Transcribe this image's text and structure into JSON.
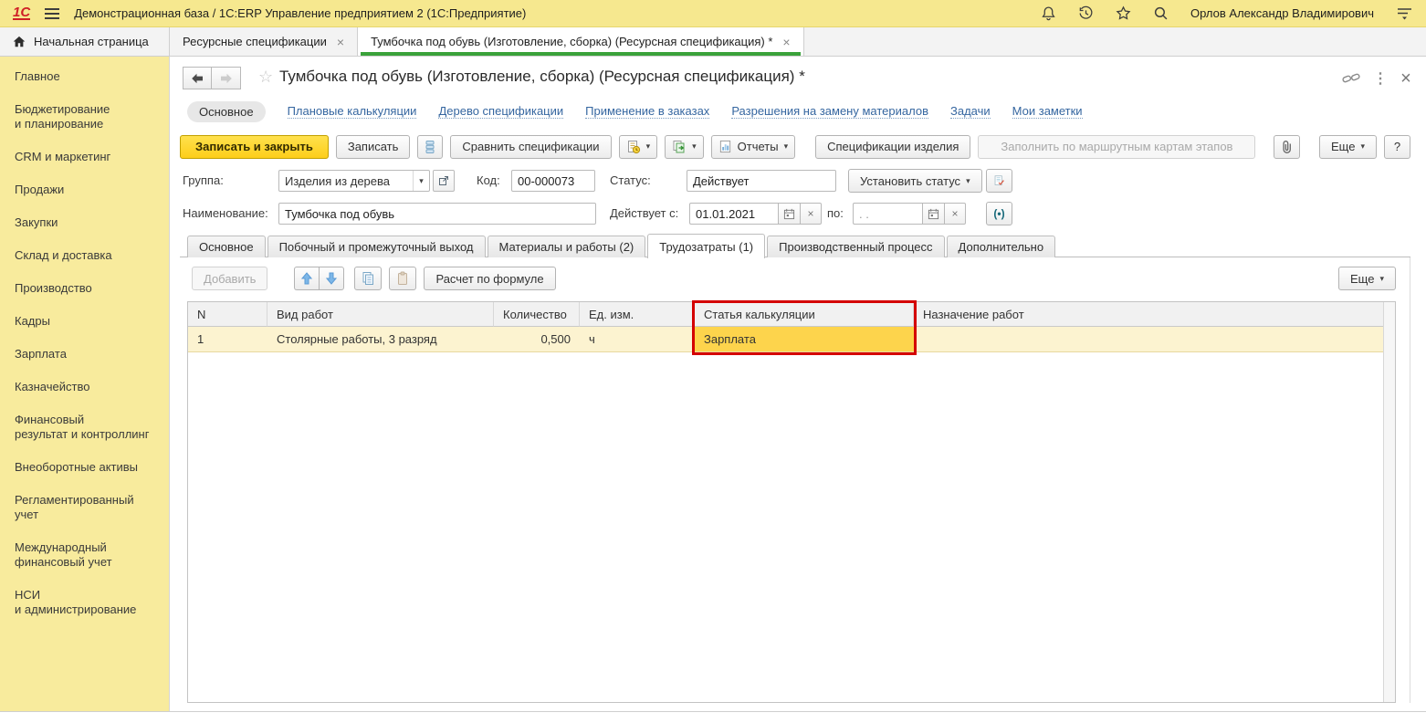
{
  "colors": {
    "topbar_bg": "#f6e88f",
    "sidebar_bg": "#f8eb9d",
    "primary_button_yellow": "#ffd633",
    "active_tab_underline_green": "#3aa23a",
    "annotation_red": "#d40000",
    "selected_row_bg": "#fcf3d0",
    "highlight_cell_bg": "#fdd44c",
    "link_blue": "#3566a0"
  },
  "glyphs": {
    "caret_down": "▾",
    "close": "×",
    "star_outline": "☆",
    "kebab": "⋮",
    "period": "(•)",
    "window_close": "×"
  },
  "titlebar": {
    "logo": "1С",
    "title": "Демонстрационная база / 1С:ERP Управление предприятием 2  (1С:Предприятие)",
    "user": "Орлов Александр Владимирович"
  },
  "tabbar": {
    "home": "Начальная страница",
    "tabs": [
      {
        "label": "Ресурсные спецификации"
      },
      {
        "label": "Тумбочка под обувь (Изготовление, сборка) (Ресурсная спецификация) *"
      }
    ]
  },
  "sidebar": {
    "items": [
      "Главное",
      "Бюджетирование\nи планирование",
      "CRM и маркетинг",
      "Продажи",
      "Закупки",
      "Склад и доставка",
      "Производство",
      "Кадры",
      "Зарплата",
      "Казначейство",
      "Финансовый\nрезультат и контроллинг",
      "Внеоборотные активы",
      "Регламентированный\nучет",
      "Международный\nфинансовый учет",
      "НСИ\nи администрирование"
    ]
  },
  "form": {
    "title": "Тумбочка под обувь (Изготовление, сборка) (Ресурсная спецификация) *",
    "nav": {
      "active": "Основное",
      "links": [
        "Плановые калькуляции",
        "Дерево спецификации",
        "Применение в заказах",
        "Разрешения на замену материалов",
        "Задачи",
        "Мои заметки"
      ]
    },
    "toolbar": {
      "save_close": "Записать и закрыть",
      "save": "Записать",
      "compare": "Сравнить спецификации",
      "reports": "Отчеты",
      "product_specs": "Спецификации изделия",
      "fill_by_route_maps": "Заполнить по маршрутным картам этапов",
      "more": "Еще",
      "help": "?"
    },
    "fields": {
      "group_label": "Группа:",
      "group_value": "Изделия из дерева",
      "code_label": "Код:",
      "code_value": "00-000073",
      "status_label": "Статус:",
      "status_value": "Действует",
      "set_status_button": "Установить статус",
      "name_label": "Наименование:",
      "name_value": "Тумбочка под обувь",
      "valid_from_label": "Действует с:",
      "valid_from_value": "01.01.2021",
      "valid_to_label": "по:",
      "valid_to_value": ". ."
    },
    "tabs": [
      "Основное",
      "Побочный и промежуточный выход",
      "Материалы и работы (2)",
      "Трудозатраты (1)",
      "Производственный процесс",
      "Дополнительно"
    ],
    "active_tab": "Трудозатраты (1)",
    "table_toolbar": {
      "add": "Добавить",
      "calc_formula": "Расчет по формуле",
      "more": "Еще"
    },
    "table": {
      "columns": [
        "N",
        "Вид работ",
        "Количество",
        "Ед. изм.",
        "Статья калькуляции",
        "Назначение работ"
      ],
      "rows": [
        {
          "n": "1",
          "work": "Столярные работы, 3 разряд",
          "qty": "0,500",
          "unit": "ч",
          "cost_item": "Зарплата",
          "purpose": ""
        }
      ]
    }
  }
}
